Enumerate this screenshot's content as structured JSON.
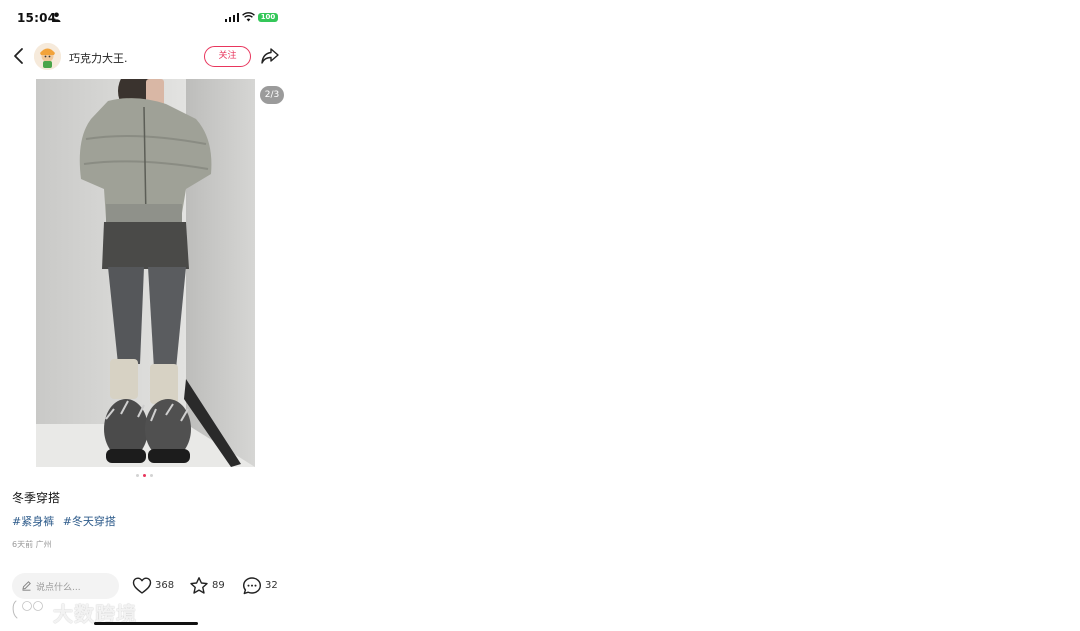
{
  "status_bar": {
    "time": "15:04",
    "battery": "100",
    "icons": [
      "person-icon",
      "signal-icon",
      "wifi-icon",
      "battery-icon"
    ]
  },
  "header": {
    "username": "巧克力大王.",
    "follow_label": "关注",
    "icons": [
      "back-icon",
      "share-icon"
    ]
  },
  "photo": {
    "page_indicator": "2/3",
    "current_page": 2,
    "total_pages": 3
  },
  "post": {
    "title": "冬季穿搭",
    "tags": [
      "#紧身裤",
      "#冬天穿搭"
    ],
    "meta": "6天前 广州"
  },
  "bottom_bar": {
    "comment_placeholder": "说点什么...",
    "likes": "368",
    "collects": "89",
    "comments": "32",
    "icons": [
      "pencil-icon",
      "heart-icon",
      "star-icon",
      "comment-icon"
    ]
  },
  "watermark": {
    "text": "大数跨境"
  },
  "colors": {
    "accent": "#e8365d",
    "tag": "#2c5a8a",
    "battery": "#34c759"
  }
}
